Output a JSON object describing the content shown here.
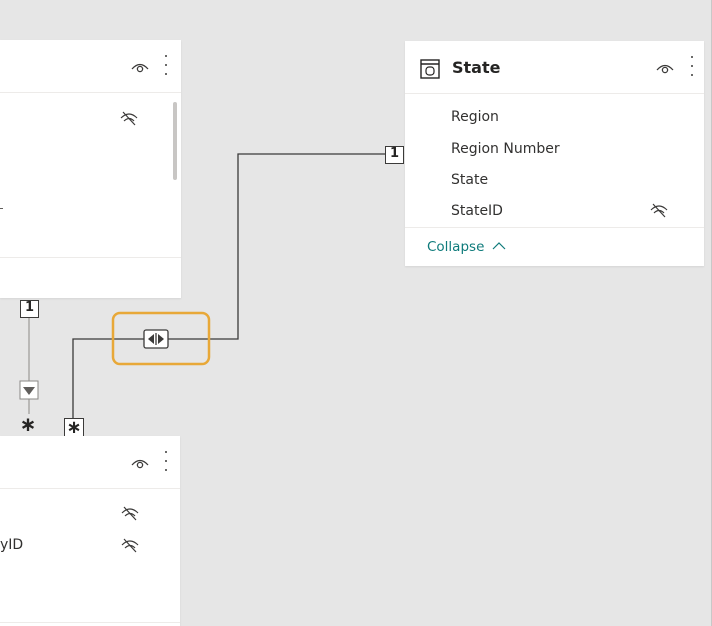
{
  "state_table": {
    "title": "State",
    "fields": [
      "Region",
      "Region Number",
      "State",
      "StateID"
    ],
    "collapse_label": "Collapse"
  },
  "left_bottom_table": {
    "partial_field": "yID"
  },
  "relationships": {
    "state_one": "1",
    "left_one": "1",
    "many_a": "∗",
    "many_b": "∗"
  },
  "highlight_color": "#e8a838"
}
